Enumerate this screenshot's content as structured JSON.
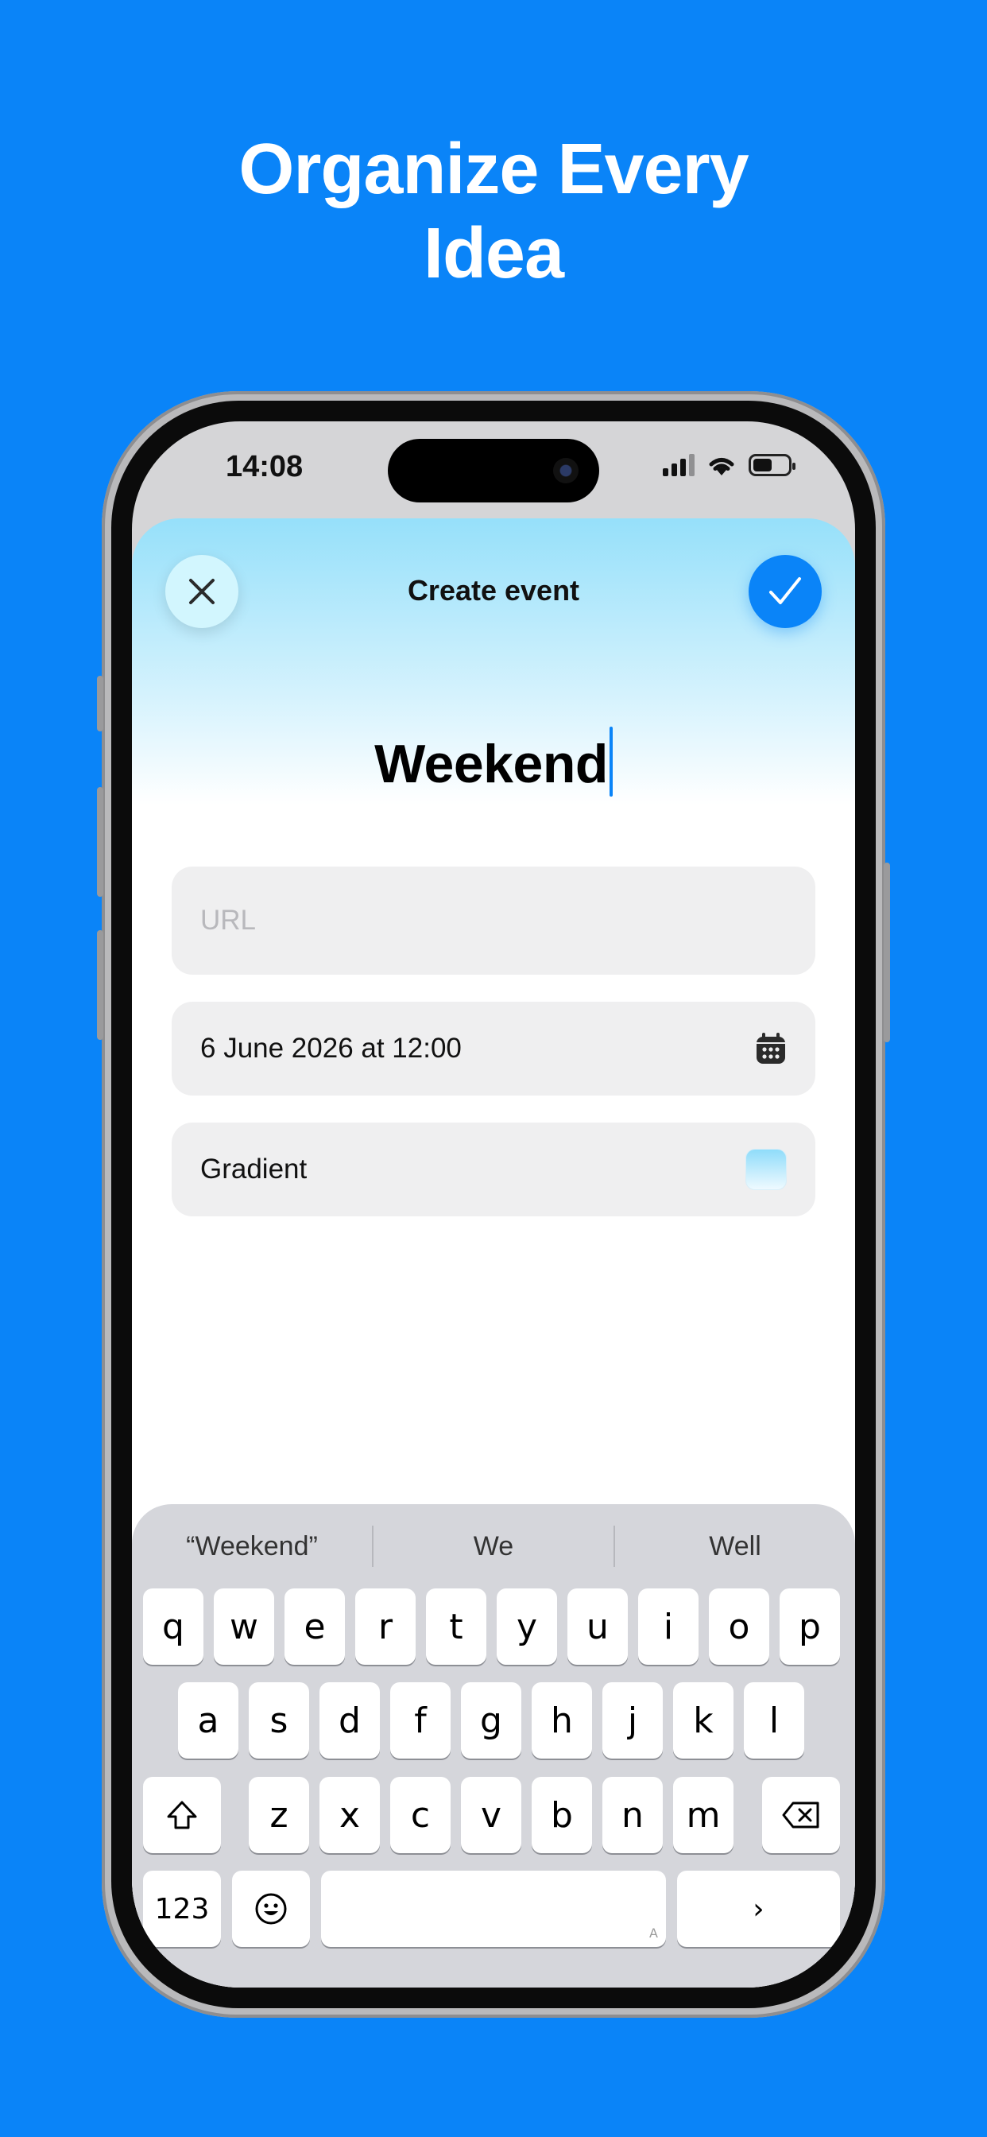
{
  "headline": {
    "line1": "Organize Every",
    "line2": "Idea"
  },
  "status_bar": {
    "time": "14:08"
  },
  "sheet": {
    "title": "Create event",
    "event_name": "Weekend",
    "url_placeholder": "URL",
    "date_value": "6 June 2026 at 12:00",
    "gradient_label": "Gradient"
  },
  "keyboard": {
    "suggestions": [
      "“Weekend”",
      "We",
      "Well"
    ],
    "row1": [
      "q",
      "w",
      "e",
      "r",
      "t",
      "y",
      "u",
      "i",
      "o",
      "p"
    ],
    "row2": [
      "a",
      "s",
      "d",
      "f",
      "g",
      "h",
      "j",
      "k",
      "l"
    ],
    "row3": [
      "z",
      "x",
      "c",
      "v",
      "b",
      "n",
      "m"
    ],
    "numbers_label": "123",
    "return_label": "›",
    "space_hint": "A"
  },
  "colors": {
    "background": "#0A84F8",
    "accent": "#0A84F8",
    "sheet_gradient_top": "#96E0FA"
  }
}
